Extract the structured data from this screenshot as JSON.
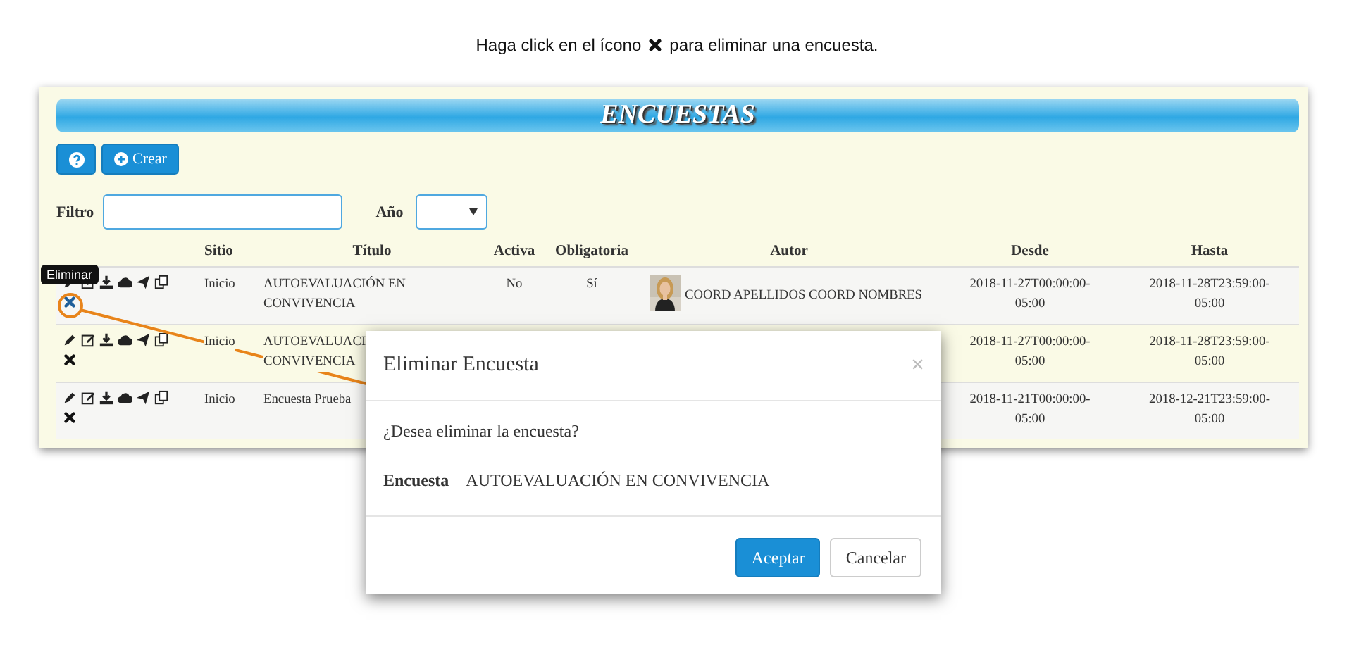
{
  "caption": {
    "before": "Haga click en el ícono",
    "after": "para eliminar una encuesta."
  },
  "page": {
    "title": "ENCUESTAS",
    "create_button": "Crear"
  },
  "filter": {
    "label": "Filtro",
    "year_label": "Año"
  },
  "table": {
    "columns": [
      "Sitio",
      "Título",
      "Activa",
      "Obligatoria",
      "Autor",
      "Desde",
      "Hasta"
    ],
    "rows": [
      {
        "sitio": "Inicio",
        "titulo": "AUTOEVALUACIÓN EN CONVIVENCIA",
        "activa": "No",
        "obligatoria": "Sí",
        "autor": "COORD APELLIDOS COORD NOMBRES",
        "desde": "2018-11-27T00:00:00-05:00",
        "hasta": "2018-11-28T23:59:00-05:00",
        "highlighted": true
      },
      {
        "sitio": "Inicio",
        "titulo": "AUTOEVALUACI CONVIVENCIA",
        "desde": "2018-11-27T00:00:00-05:00",
        "hasta": "2018-11-28T23:59:00-05:00",
        "highlighted": false
      },
      {
        "sitio": "Inicio",
        "titulo": "Encuesta Prueba",
        "desde": "2018-11-21T00:00:00-05:00",
        "hasta": "2018-12-21T23:59:00-05:00",
        "highlighted": false
      }
    ]
  },
  "tooltip": {
    "text": "Eliminar"
  },
  "modal": {
    "title": "Eliminar Encuesta",
    "close": "×",
    "question": "¿Desea eliminar la encuesta?",
    "label": "Encuesta",
    "value": "AUTOEVALUACIÓN EN CONVIVENCIA",
    "buttons": [
      {
        "label": "Aceptar",
        "kind": "primary"
      },
      {
        "label": "Cancelar",
        "kind": "default"
      }
    ]
  }
}
